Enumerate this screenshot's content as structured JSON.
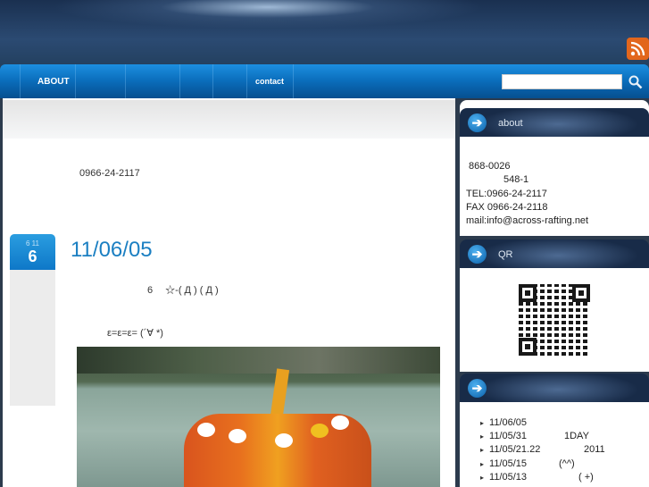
{
  "nav": {
    "items": [
      "ABOUT",
      "contact"
    ],
    "search_value": ""
  },
  "main": {
    "phone": "0966-24-2117",
    "post": {
      "badge_month": "6 11",
      "badge_day": "6",
      "title": "11/06/05",
      "line1": "6　 ☆-(  Д ) ( Д  )",
      "line2": "ε=ε=ε= (´∀ *)"
    }
  },
  "sidebar": {
    "about": {
      "title": "about",
      "lines": [
        "868-0026",
        "548-1",
        "TEL:0966-24-2117",
        "FAX 0966-24-2118",
        "mail:info@across-rafting.net"
      ]
    },
    "qr": {
      "title": "QR"
    },
    "recent": {
      "title": "",
      "items": [
        {
          "date": "11/06/05",
          "text": ""
        },
        {
          "date": "11/05/31",
          "text": "1DAY"
        },
        {
          "date": "11/05/21.22",
          "text": "2011"
        },
        {
          "date": "11/05/15",
          "text": "(^^)"
        },
        {
          "date": "11/05/13",
          "text": "(  +)"
        }
      ]
    }
  },
  "colors": {
    "accent": "#1b7fc2",
    "nav": "#0a6cba",
    "rss": "#e2661c"
  }
}
